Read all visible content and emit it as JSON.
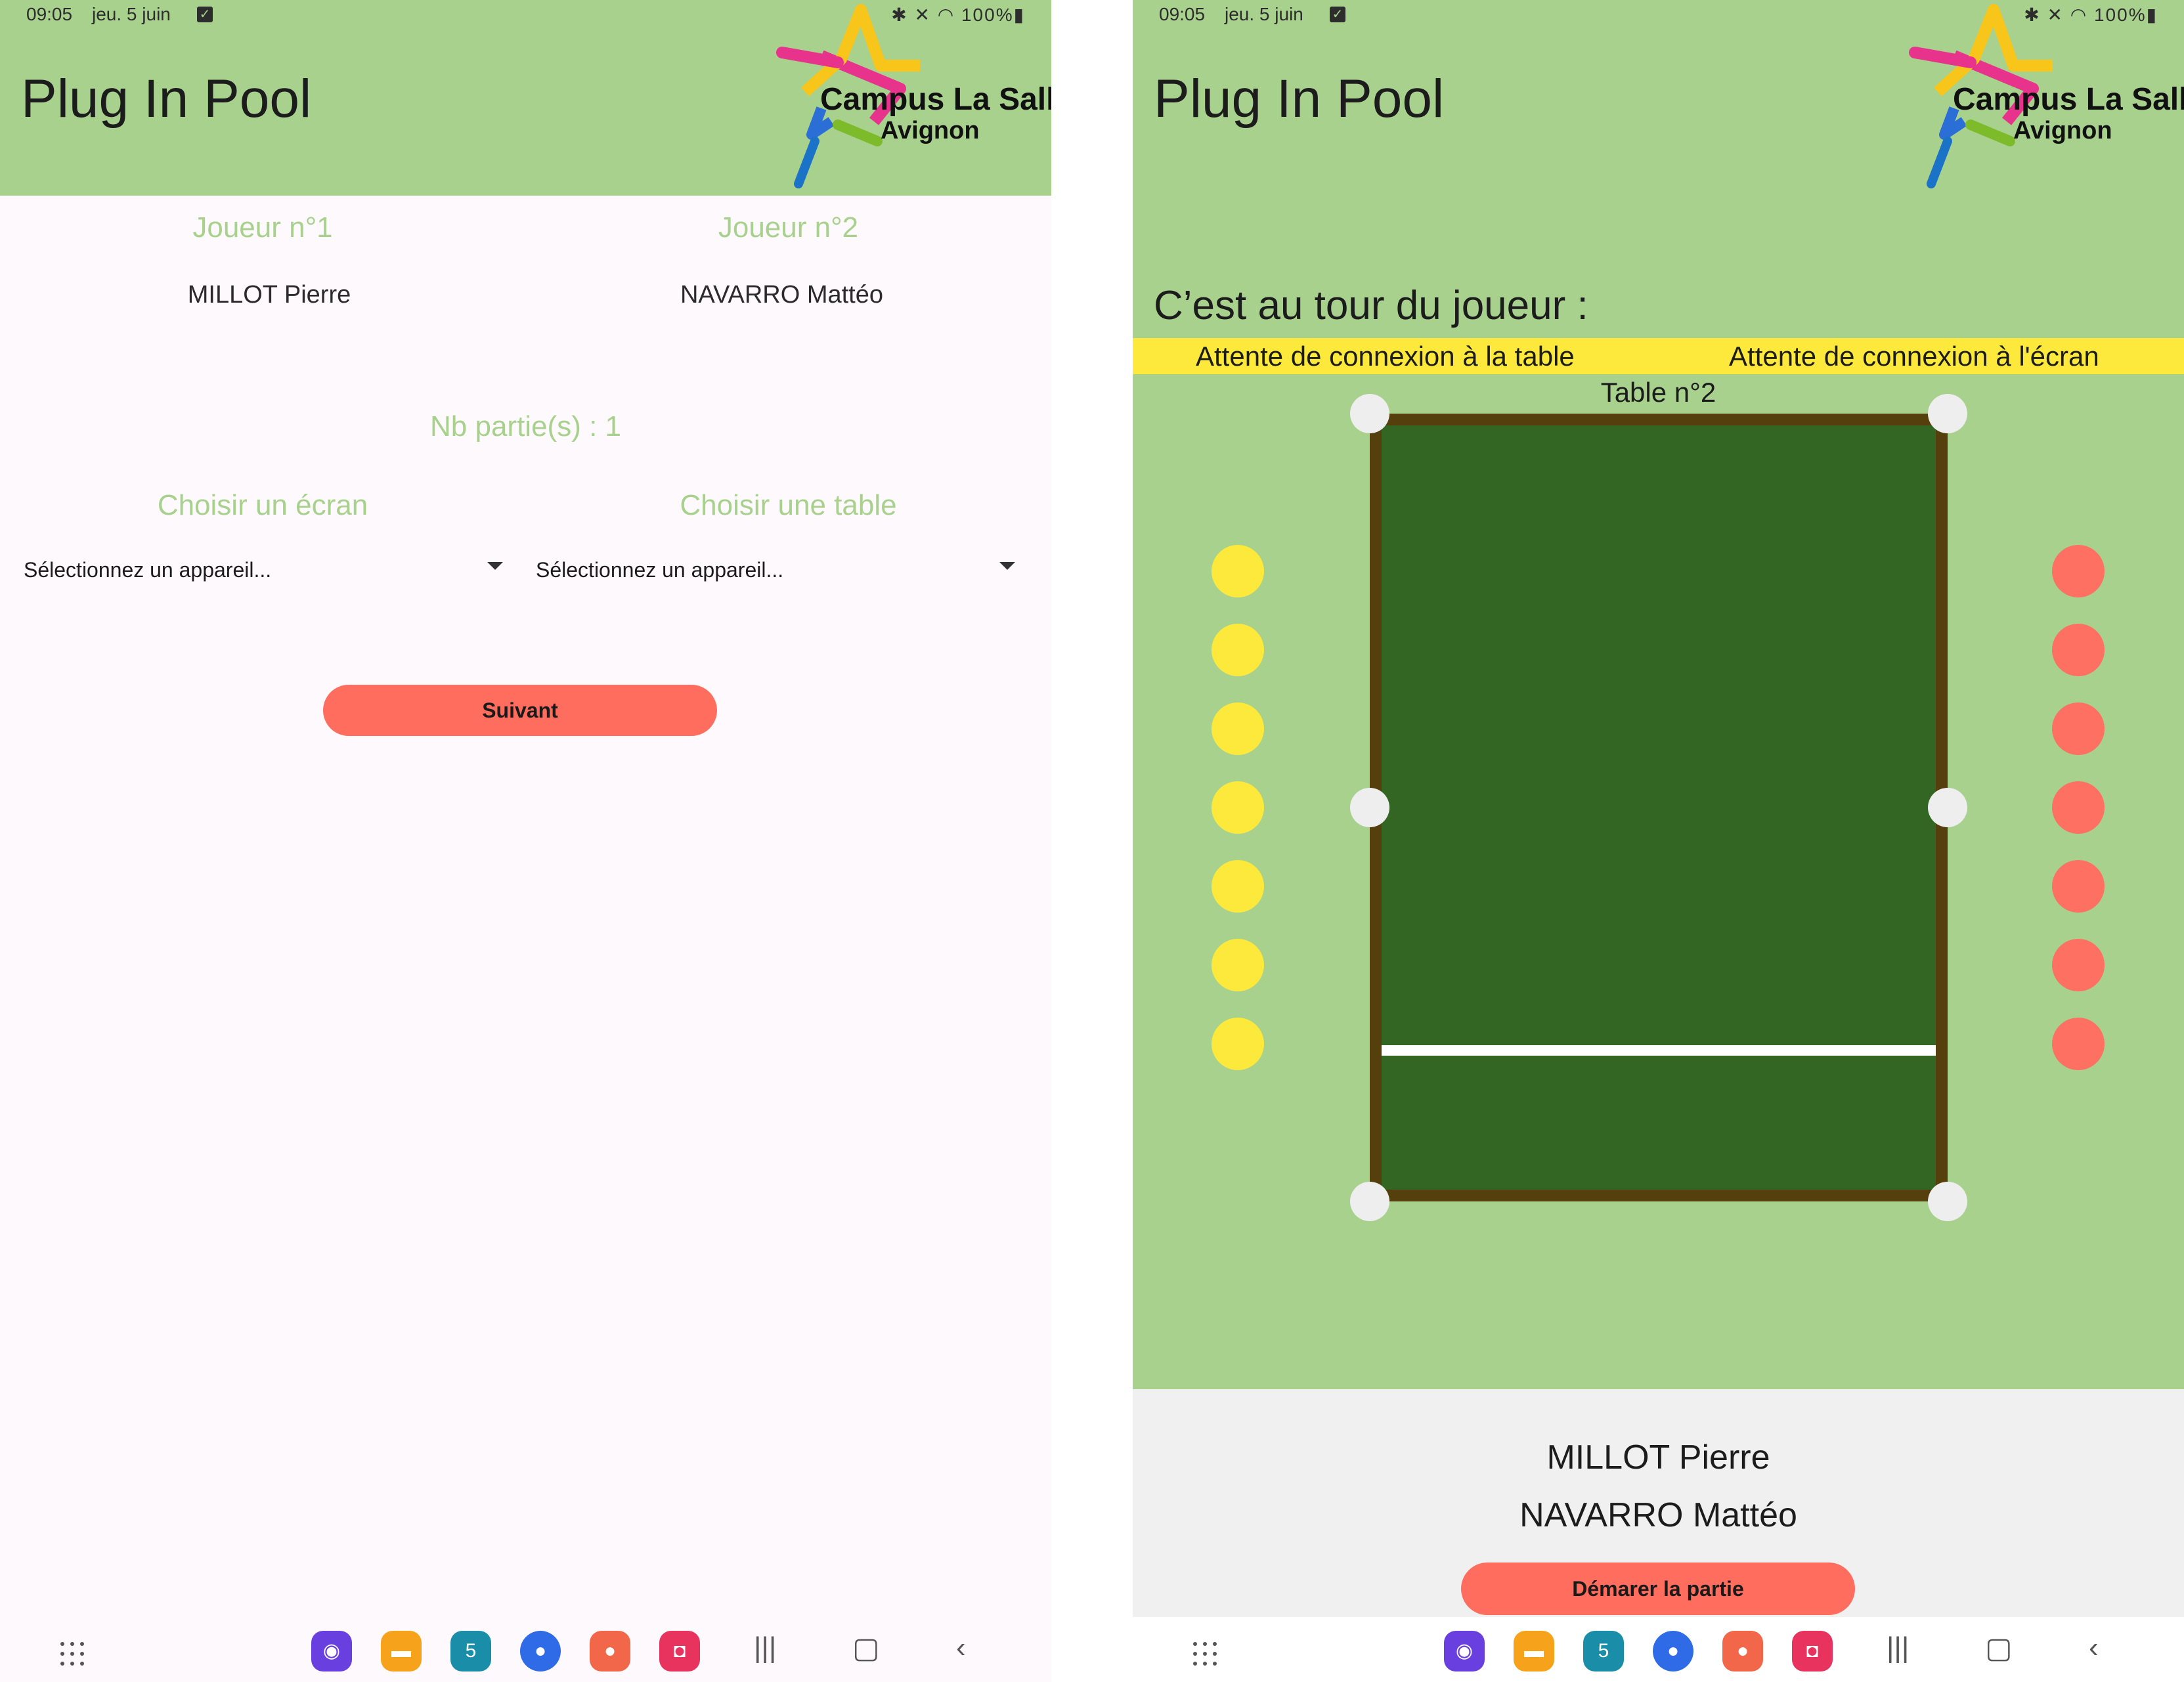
{
  "status_bar": {
    "time": "09:05",
    "date": "jeu. 5 juin",
    "icons_text": "✱ ✕ ◠ 100%▮",
    "battery": "100%"
  },
  "app": {
    "title": "Plug In Pool"
  },
  "logo": {
    "line1": "Campus La Salle",
    "line2": "Avignon"
  },
  "config_screen": {
    "player1_header": "Joueur n°1",
    "player2_header": "Joueur n°2",
    "player1_name": "MILLOT Pierre",
    "player2_name": "NAVARRO Mattéo",
    "games_count": "Nb partie(s) : 1",
    "screen_header": "Choisir un écran",
    "table_header": "Choisir une table",
    "screen_select_value": "Sélectionnez un appareil...",
    "table_select_value": "Sélectionnez un appareil...",
    "next_button": "Suivant"
  },
  "game_screen": {
    "turn_label": "C’est au tour du joueur :",
    "table_status": "Attente de connexion à la table",
    "screen_status": "Attente de connexion à l'écran",
    "table_label": "Table n°2",
    "yellow_balls_remaining": 7,
    "red_balls_remaining": 7,
    "player1_name": "MILLOT Pierre",
    "player2_name": "NAVARRO Mattéo",
    "start_button": "Démarer la partie"
  },
  "nav_bar": {
    "apps": [
      {
        "name": "internet-icon",
        "color": "#6a3fe0"
      },
      {
        "name": "files-icon",
        "color": "#f7a21b"
      },
      {
        "name": "calendar-icon",
        "color": "#1a8ea8",
        "text": "5"
      },
      {
        "name": "messages-icon",
        "color": "#2f6be6"
      },
      {
        "name": "contacts-icon",
        "color": "#f2674a"
      },
      {
        "name": "screen-recorder-icon",
        "color": "#e8335e"
      }
    ],
    "recents_symbol": "|||",
    "home_symbol": "▢",
    "back_symbol": "‹"
  },
  "colors": {
    "app_bar": "#a8d18e",
    "accent_button": "#ff6d5e",
    "banner": "#fde93c",
    "table_rail": "#55400d",
    "table_felt": "#336622",
    "yellow_ball": "#fde93c",
    "red_ball": "#fd7062"
  }
}
